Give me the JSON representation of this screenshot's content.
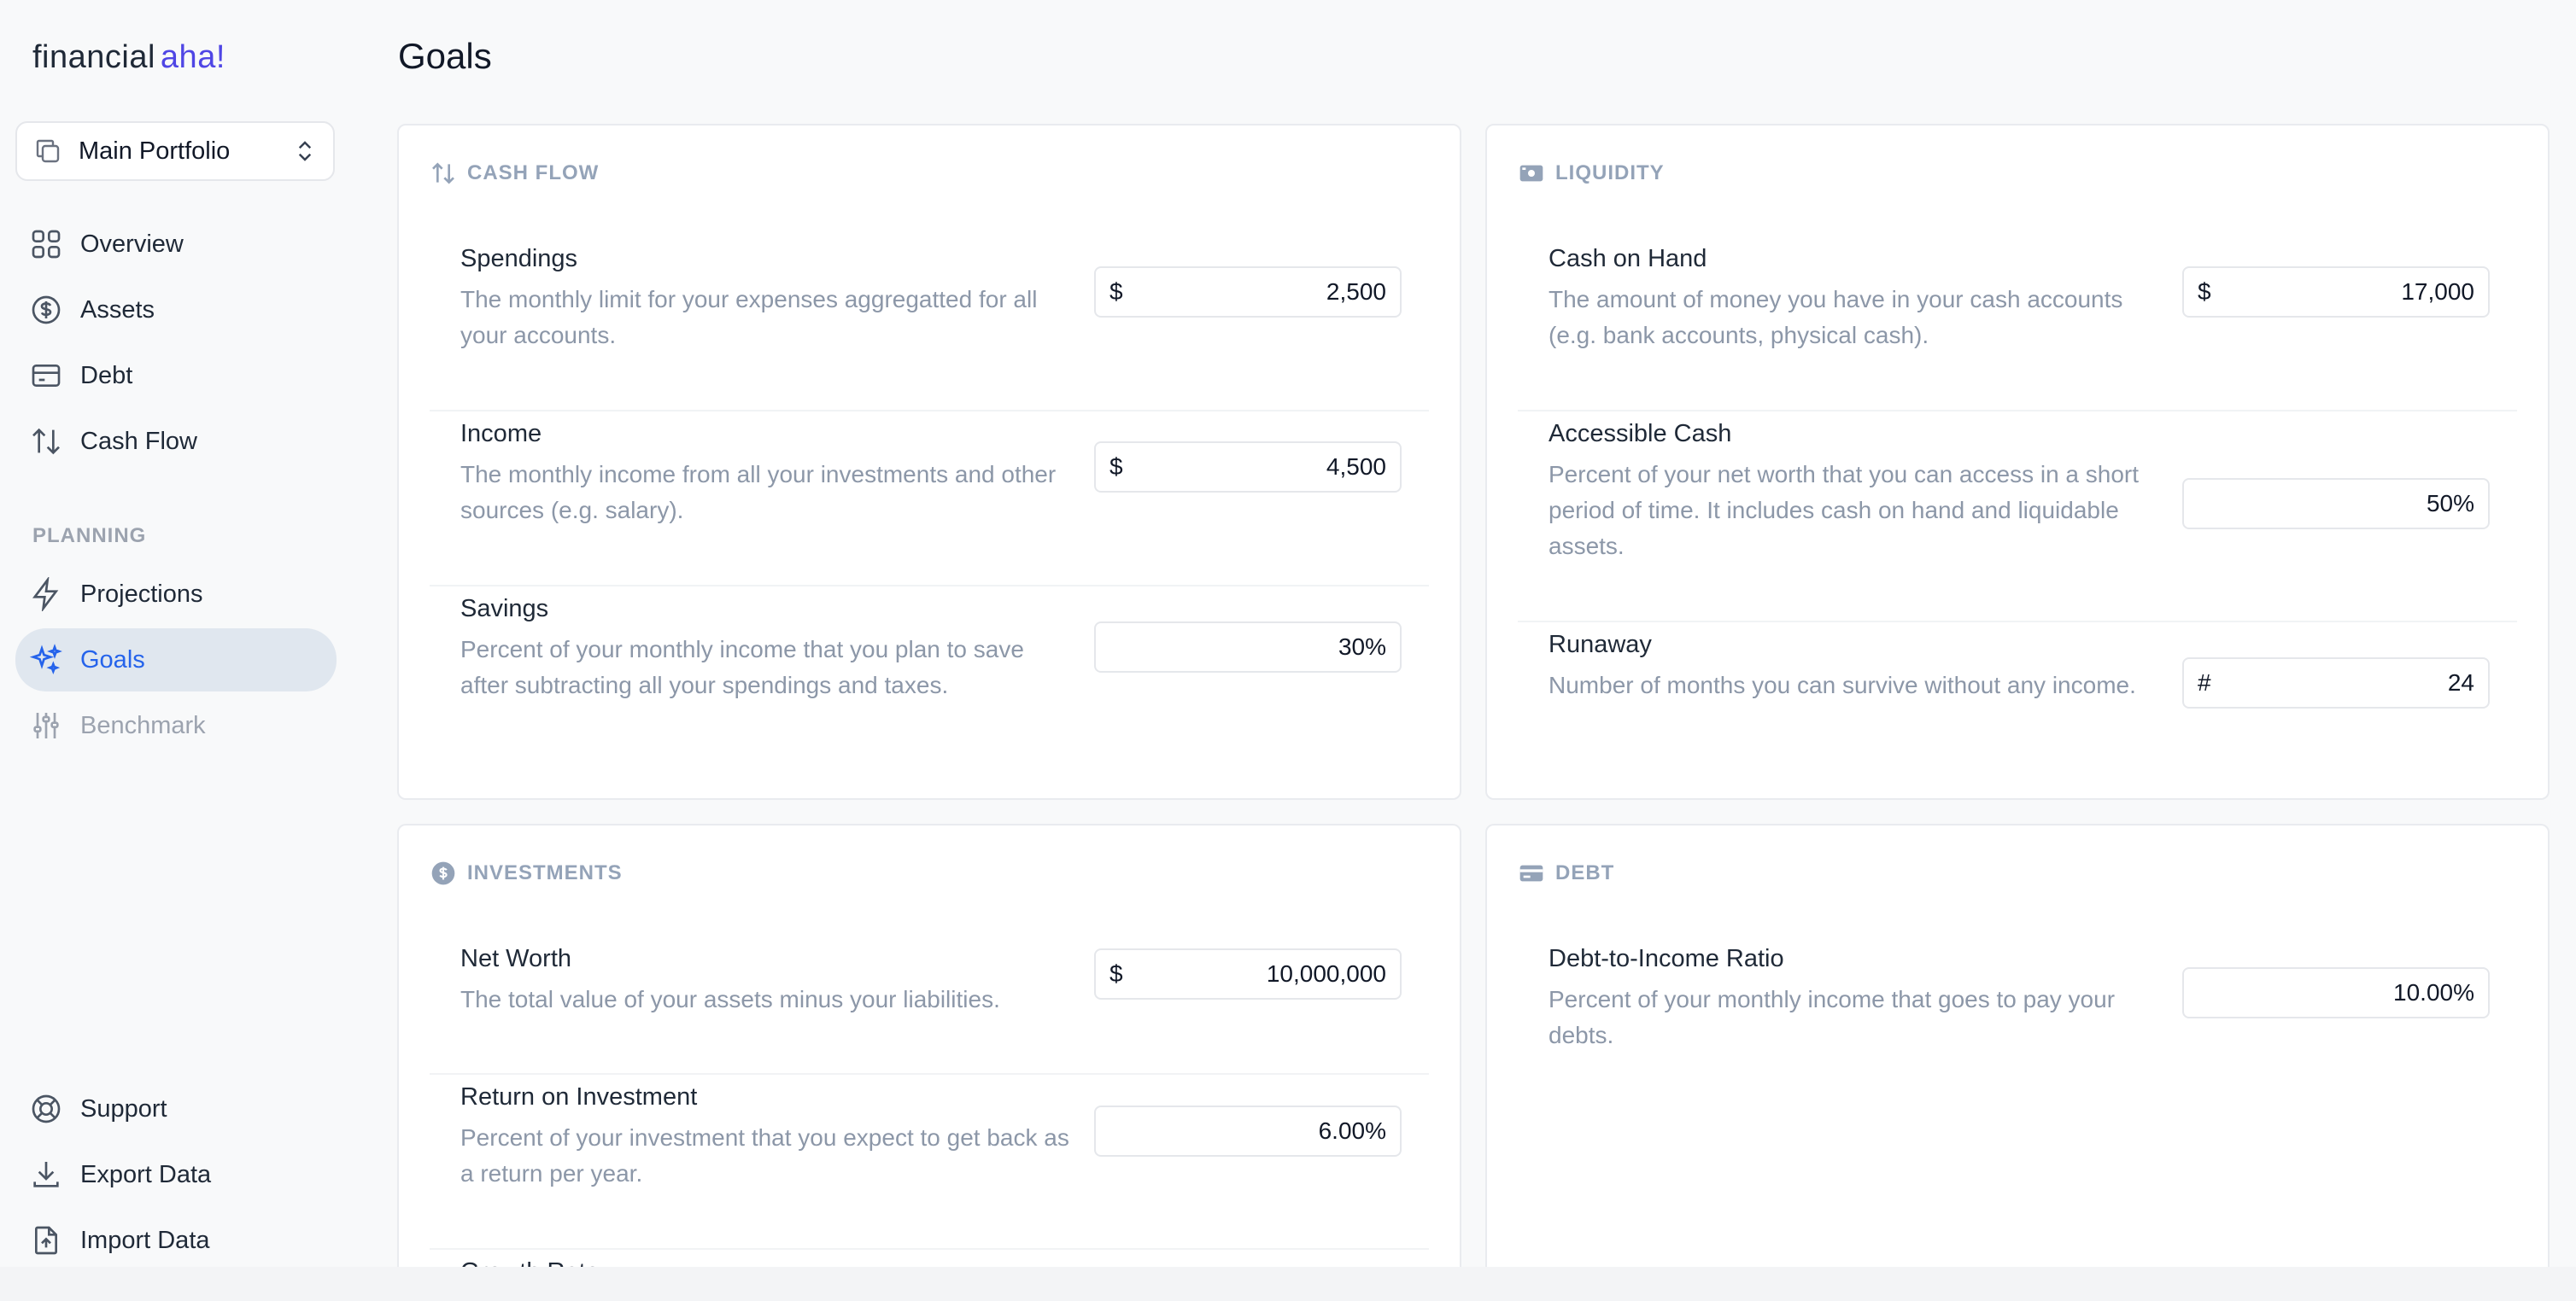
{
  "brand": {
    "part1": "financial",
    "part2": "aha!"
  },
  "portfolio": {
    "label": "Main Portfolio"
  },
  "nav": {
    "overview": "Overview",
    "assets": "Assets",
    "debt": "Debt",
    "cashflow": "Cash Flow",
    "planning_label": "PLANNING",
    "projections": "Projections",
    "goals": "Goals",
    "benchmark": "Benchmark",
    "support": "Support",
    "export": "Export Data",
    "import": "Import Data"
  },
  "page": {
    "title": "Goals"
  },
  "cards": {
    "cashflow": {
      "heading": "CASH FLOW",
      "spendings": {
        "title": "Spendings",
        "desc": "The monthly limit for your expenses aggregatted for all your accounts.",
        "prefix": "$",
        "value": "2,500"
      },
      "income": {
        "title": "Income",
        "desc": "The monthly income from all your investments and other sources (e.g. salary).",
        "prefix": "$",
        "value": "4,500"
      },
      "savings": {
        "title": "Savings",
        "desc": "Percent of your monthly income that you plan to save after subtracting all your spendings and taxes.",
        "value": "30%"
      }
    },
    "liquidity": {
      "heading": "LIQUIDITY",
      "cash_on_hand": {
        "title": "Cash on Hand",
        "desc": "The amount of money you have in your cash accounts (e.g. bank accounts, physical cash).",
        "prefix": "$",
        "value": "17,000"
      },
      "accessible_cash": {
        "title": "Accessible Cash",
        "desc": "Percent of your net worth that you can access in a short period of time. It includes cash on hand and liquidable assets.",
        "value": "50%"
      },
      "runaway": {
        "title": "Runaway",
        "desc": "Number of months you can survive without any income.",
        "prefix": "#",
        "value": "24"
      }
    },
    "investments": {
      "heading": "INVESTMENTS",
      "net_worth": {
        "title": "Net Worth",
        "desc": "The total value of your assets minus your liabilities.",
        "prefix": "$",
        "value": "10,000,000"
      },
      "roi": {
        "title": "Return on Investment",
        "desc": "Percent of your investment that you expect to get back as a return per year.",
        "value": "6.00%"
      },
      "growth": {
        "title": "Growth Rate"
      }
    },
    "debt": {
      "heading": "DEBT",
      "dti": {
        "title": "Debt-to-Income Ratio",
        "desc": "Percent of your monthly income that goes to pay your debts.",
        "value": "10.00%"
      }
    }
  }
}
